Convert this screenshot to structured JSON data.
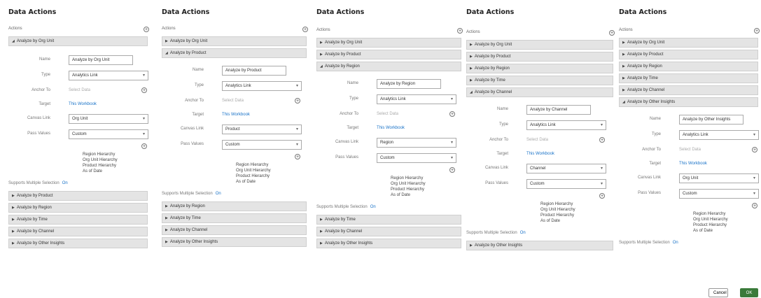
{
  "panels": [
    {
      "title": "Data Actions",
      "actions_label": "Actions",
      "rows_above": [],
      "expanded": "Analyze by Org Unit",
      "form": {
        "name_label": "Name",
        "name_value": "Analyze by Org Unit",
        "type_label": "Type",
        "type_value": "Analytics Link",
        "anchor_label": "Anchor To",
        "anchor_placeholder": "Select Data",
        "target_label": "Target",
        "target_value": "This Workbook",
        "canvas_label": "Canvas Link",
        "canvas_value": "Org Unit",
        "pass_label": "Pass Values",
        "pass_value": "Custom"
      },
      "values": [
        "Region Hierarchy",
        "Org Unit Hierarchy",
        "Product Hierarchy",
        "As of Date"
      ],
      "sms_label": "Supports Multiple Selection",
      "sms_value": "On",
      "rows_below": [
        "Analyze by Product",
        "Analyze by Region",
        "Analyze by Time",
        "Analyze by Channel",
        "Analyze by Other Insights"
      ]
    },
    {
      "title": "Data Actions",
      "actions_label": "Actions",
      "rows_above": [
        "Analyze by Org Unit"
      ],
      "expanded": "Analyze by Product",
      "form": {
        "name_label": "Name",
        "name_value": "Analyze by Product",
        "type_label": "Type",
        "type_value": "Analytics Link",
        "anchor_label": "Anchor To",
        "anchor_placeholder": "Select Data",
        "target_label": "Target",
        "target_value": "This Workbook",
        "canvas_label": "Canvas Link",
        "canvas_value": "Product",
        "pass_label": "Pass Values",
        "pass_value": "Custom"
      },
      "values": [
        "Region Hierarchy",
        "Org Unit Hierarchy",
        "Product Hierarchy",
        "As of Date"
      ],
      "sms_label": "Supports Multiple Selection",
      "sms_value": "On",
      "rows_below": [
        "Analyze by Region",
        "Analyze by Time",
        "Analyze by Channel",
        "Analyze by Other Insights"
      ]
    },
    {
      "title": "Data Actions",
      "actions_label": "Actions",
      "rows_above": [
        "Analyze by Org Unit",
        "Analyze by Product"
      ],
      "expanded": "Analyze by Region",
      "form": {
        "name_label": "Name",
        "name_value": "Analyze by Region",
        "type_label": "Type",
        "type_value": "Analytics Link",
        "anchor_label": "Anchor To",
        "anchor_placeholder": "Select Data",
        "target_label": "Target",
        "target_value": "This Workbook",
        "canvas_label": "Canvas Link",
        "canvas_value": "Region",
        "pass_label": "Pass Values",
        "pass_value": "Custom"
      },
      "values": [
        "Region Hierarchy",
        "Org Unit Hierarchy",
        "Product Hierarchy",
        "As of Date"
      ],
      "sms_label": "Supports Multiple Selection",
      "sms_value": "On",
      "rows_below": [
        "Analyze by Time",
        "Analyze by Channel",
        "Analyze by Other Insights"
      ]
    },
    {
      "title": "Data Actions",
      "actions_label": "Actions",
      "rows_above": [
        "Analyze by Org Unit",
        "Analyze by Product",
        "Analyze by Region",
        "Analyze by Time"
      ],
      "expanded": "Analyze by Channel",
      "form": {
        "name_label": "Name",
        "name_value": "Analyze by Channel",
        "type_label": "Type",
        "type_value": "Analytics Link",
        "anchor_label": "Anchor To",
        "anchor_placeholder": "Select Data",
        "target_label": "Target",
        "target_value": "This Workbook",
        "canvas_label": "Canvas Link",
        "canvas_value": "Channel",
        "pass_label": "Pass Values",
        "pass_value": "Custom"
      },
      "values": [
        "Region Hierarchy",
        "Org Unit Hierarchy",
        "Product Hierarchy",
        "As of Date"
      ],
      "sms_label": "Supports Multiple Selection",
      "sms_value": "On",
      "rows_below": [
        "Analyze by Other Insights"
      ]
    },
    {
      "title": "Data Actions",
      "actions_label": "Actions",
      "rows_above": [
        "Analyze by Org Unit",
        "Analyze by Product",
        "Analyze by Region",
        "Analyze by Time",
        "Analyze by Channel"
      ],
      "expanded": "Analyze by Other Insights",
      "form": {
        "name_label": "Name",
        "name_value": "Analyze by Other Insights",
        "type_label": "Type",
        "type_value": "Analytics Link",
        "anchor_label": "Anchor To",
        "anchor_placeholder": "Select Data",
        "target_label": "Target",
        "target_value": "This Workbook",
        "canvas_label": "Canvas Link",
        "canvas_value": "Org Unit",
        "pass_label": "Pass Values",
        "pass_value": "Custom"
      },
      "values": [
        "Region Hierarchy",
        "Org Unit Hierarchy",
        "Product Hierarchy",
        "As of Date"
      ],
      "sms_label": "Supports Multiple Selection",
      "sms_value": "On",
      "rows_below": []
    }
  ],
  "footer": {
    "cancel_label": "Cancel",
    "ok_label": "OK"
  },
  "icons": {
    "add": "plus-circle-icon",
    "collapsed": "triangle-right-icon",
    "expanded": "triangle-down-icon",
    "dropdown": "chevron-down-icon"
  },
  "colors": {
    "link": "#1a73c8",
    "row_bg": "#e4e4e4",
    "ok_bg": "#3a7a3a"
  }
}
